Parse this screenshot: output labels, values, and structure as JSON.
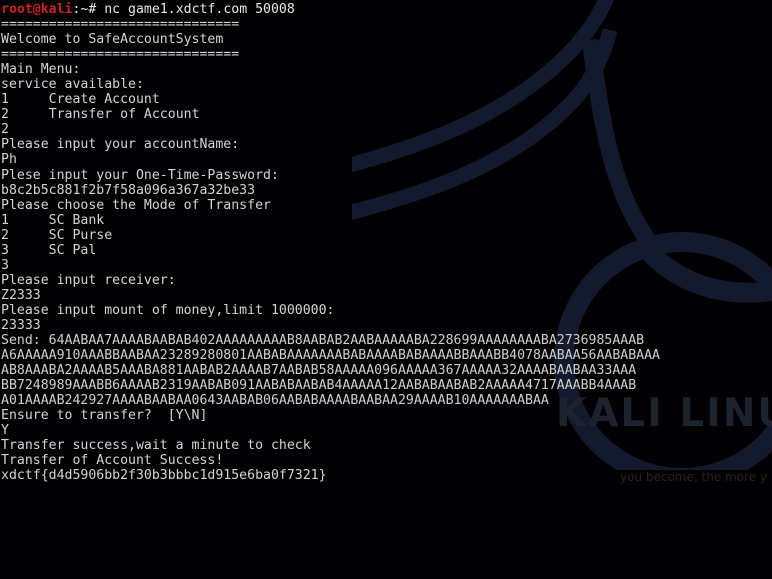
{
  "window": {
    "title": "root@kali: ~",
    "background_color": "#010103",
    "foreground_color": "#d8d8d8",
    "prompt_color": "#cc2020"
  },
  "wallpaper": {
    "watermark_title": "KALI LINUX",
    "watermark_tagline": "you become, the more y",
    "swoosh_color": "#141a2e"
  },
  "prompt": {
    "user_host": "root@kali",
    "path_sigil": ":~#",
    "command": " nc game1.xdctf.com 50008"
  },
  "session": {
    "rule_top": "==============================",
    "banner": "Welcome to SafeAccountSystem",
    "rule_bottom": "==============================",
    "main_menu_label": "Main Menu:",
    "service_label": "service available:",
    "menu_items": [
      {
        "key": "1",
        "label": "Create Account"
      },
      {
        "key": "2",
        "label": "Transfer of Account"
      }
    ],
    "menu_choice": "2",
    "prompt_account_name": "Please input your accountName:",
    "input_account_name": "Ph",
    "prompt_otp": "Plese input your One-Time-Password:",
    "input_otp": "b8c2b5c881f2b7f58a096a367a32be33",
    "prompt_mode": "Please choose the Mode of Transfer",
    "mode_items": [
      {
        "key": "1",
        "label": "SC Bank"
      },
      {
        "key": "2",
        "label": "SC Purse"
      },
      {
        "key": "3",
        "label": "SC Pal"
      }
    ],
    "mode_choice": "3",
    "prompt_receiver": "Please input receiver:",
    "input_receiver": "Z2333",
    "prompt_amount": "Please input mount of money,limit 1000000:",
    "input_amount": "23333",
    "send_label": "Send: ",
    "send_payload_lines": [
      "64AABAA7AAAABAABAB402AAAAAAAAAB8AABAB2AABAAAAABA228699AAAAAAAABA2736985AAAB",
      "A6AAAAA910AAABBAABAA23289280801AABABAAAAAAABABAAAABABAAAABBAAABB4078AABAA56AABABAAA",
      "AB8AAABA2AAAAB5AAABA881AABAB2AAAAB7AABAB58AAAAA096AAAAA367AAAAA32AAAABAABAA33AAA",
      "BB7248989AAABB6AAAAB2319AABAB091AABABAABAB4AAAAA12AABABAABAB2AAAAA4717AAABB4AAAB",
      "A01AAAAB242927AAAABAABAA0643AABAB06AABABAAAABAABAA29AAAAB10AAAAAAABAA"
    ],
    "prompt_confirm": "Ensure to transfer?  [Y\\N]",
    "input_confirm": "Y",
    "result_wait": "Transfer success,wait a minute to check",
    "result_success": "Transfer of Account Success!",
    "flag": "xdctf{d4d5906bb2f30b3bbbc1d915e6ba0f7321}"
  }
}
